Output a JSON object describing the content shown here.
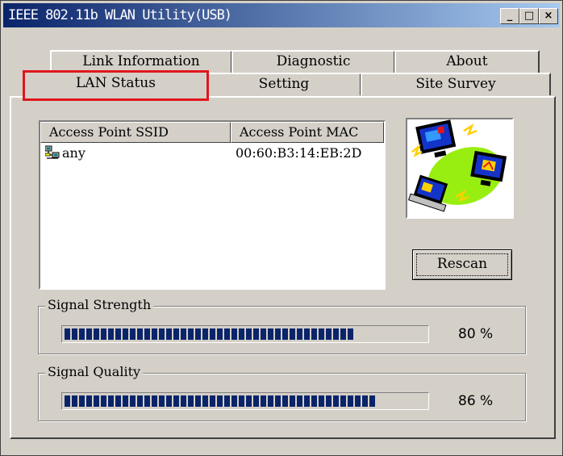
{
  "window": {
    "title": "IEEE 802.11b WLAN Utility(USB)"
  },
  "title_buttons": {
    "minimize": "_",
    "maximize": "□",
    "close": "×"
  },
  "tabs": {
    "back_row": [
      "Link Information",
      "Diagnostic",
      "About"
    ],
    "front_row": [
      "LAN Status",
      "Setting",
      "Site Survey"
    ],
    "active": "LAN Status",
    "highlight_color": "#e0161d"
  },
  "access_points": {
    "columns": [
      "Access Point SSID",
      "Access Point MAC"
    ],
    "rows": [
      {
        "ssid": "any",
        "mac": "00:60:B3:14:EB:2D",
        "icon": "network-computer-icon"
      }
    ]
  },
  "illustration": {
    "icon": "network-computers-illustration"
  },
  "buttons": {
    "rescan": "Rescan"
  },
  "signal_strength": {
    "label": "Signal Strength",
    "value_percent": 80,
    "display": "80 %"
  },
  "signal_quality": {
    "label": "Signal Quality",
    "value_percent": 86,
    "display": "86 %"
  },
  "colors": {
    "titlebar_start": "#0a246a",
    "titlebar_end": "#a6caf0",
    "progress": "#0a246a",
    "face": "#d4d0c8"
  }
}
